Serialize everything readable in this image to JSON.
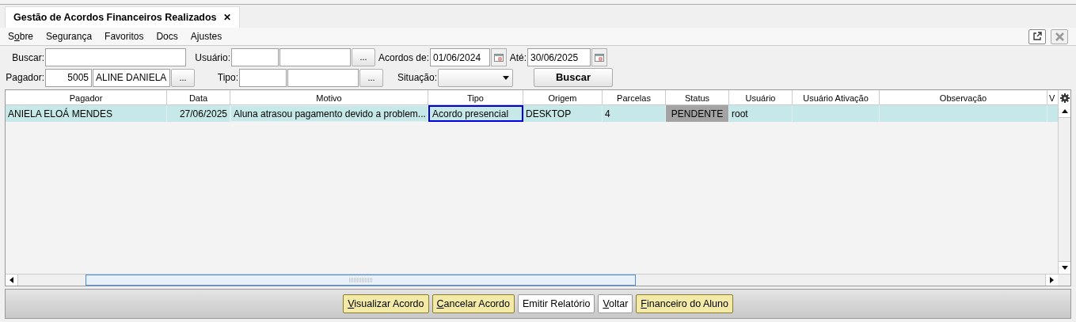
{
  "tab": {
    "title": "Gestão de Acordos Financeiros Realizados",
    "close": "✕"
  },
  "menu": [
    {
      "label": "S",
      "accel": "o",
      "rest": "bre"
    },
    {
      "label": "Segurança"
    },
    {
      "label": "Favoritos"
    },
    {
      "label": "Docs"
    },
    {
      "label": "Ajustes"
    }
  ],
  "filters": {
    "buscar": {
      "label": "Buscar:"
    },
    "usuario": {
      "label": "Usuário:",
      "lookup": "..."
    },
    "acordos_de": {
      "label": "Acordos de:",
      "value": "01/06/2024"
    },
    "ate": {
      "label": "Até:",
      "value": "30/06/2025"
    },
    "pagador": {
      "label": "Pagador:",
      "code": "5005",
      "name": "ALINE DANIELA",
      "lookup": "..."
    },
    "tipo": {
      "label": "Tipo:",
      "lookup": "..."
    },
    "situacao": {
      "label": "Situação:"
    },
    "search_button": "Buscar"
  },
  "table": {
    "columns": [
      "Pagador",
      "Data",
      "Motivo",
      "Tipo",
      "Origem",
      "Parcelas",
      "Status",
      "Usuário",
      "Usuário Ativação",
      "Observação",
      "V"
    ],
    "rows": [
      {
        "cells": [
          {
            "text": "ANIELA ELOÁ MENDES",
            "focused": false
          },
          {
            "text": "27/06/2025",
            "focused": false
          },
          {
            "text": "Aluna atrasou pagamento devido a problem...",
            "focused": false
          },
          {
            "text": "Acordo presencial",
            "focused": true
          },
          {
            "text": "DESKTOP",
            "focused": false
          },
          {
            "text": "4",
            "focused": false
          },
          {
            "text": "PENDENTE",
            "focused": false
          },
          {
            "text": "root",
            "focused": false
          },
          {
            "text": "",
            "focused": false
          },
          {
            "text": "",
            "focused": false
          }
        ]
      }
    ]
  },
  "buttons": [
    {
      "accel": "V",
      "rest": "isualizar Acordo",
      "highlighted": true
    },
    {
      "accel": "C",
      "rest": "ancelar Acordo",
      "highlighted": true
    },
    {
      "rest": "Emitir Relatório",
      "highlighted": false
    },
    {
      "accel": "V",
      "rest": "oltar",
      "highlighted": false
    },
    {
      "accel": "F",
      "rest": "inanceiro do Aluno",
      "highlighted": true
    }
  ]
}
